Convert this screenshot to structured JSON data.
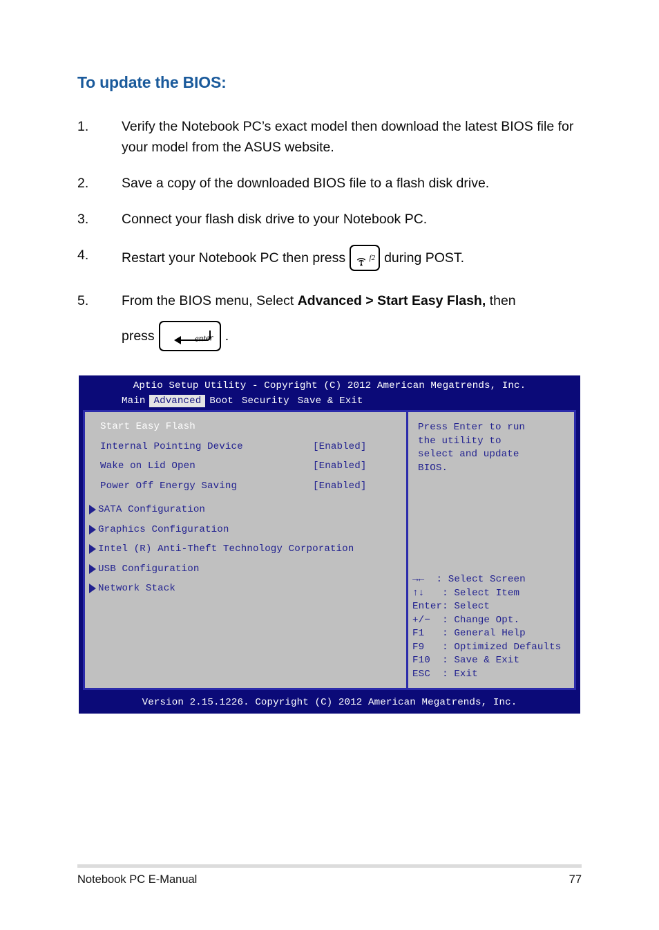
{
  "heading": "To update the BIOS:",
  "steps": [
    {
      "num": "1.",
      "text": "Verify the Notebook PC’s exact model then download the latest BIOS file for your model from the ASUS website."
    },
    {
      "num": "2.",
      "text": "Save a copy of the downloaded BIOS file to a flash disk drive."
    },
    {
      "num": "3.",
      "text": "Connect your flash disk drive to your Notebook PC."
    },
    {
      "num": "4.",
      "text_before": "Restart your Notebook PC then press",
      "key": {
        "fn_label": "f2",
        "icon": "wireless-icon"
      },
      "text_after": "during POST."
    },
    {
      "num": "5.",
      "text_before": "From the BIOS menu, Select ",
      "bold_1": "Advanced > Start Easy Flash,",
      "text_after": " then",
      "press_label": "press",
      "key": {
        "label": "enter",
        "icon": "enter-arrow-icon"
      },
      "period": "."
    }
  ],
  "bios": {
    "title": "Aptio Setup Utility - Copyright (C) 2012 American Megatrends, Inc.",
    "menu_tabs": [
      {
        "label": "Main",
        "active": false
      },
      {
        "label": "Advanced",
        "active": true
      },
      {
        "label": "Boot",
        "active": false
      },
      {
        "label": "Security",
        "active": false
      },
      {
        "label": "Save & Exit",
        "active": false
      }
    ],
    "options": [
      {
        "label": "Start Easy Flash",
        "value": "",
        "selected": true,
        "submenu": false
      },
      {
        "label": "Internal Pointing Device",
        "value": "[Enabled]",
        "selected": false,
        "submenu": false
      },
      {
        "label": "Wake on Lid Open",
        "value": "[Enabled]",
        "selected": false,
        "submenu": false
      },
      {
        "label": "Power Off Energy Saving",
        "value": "[Enabled]",
        "selected": false,
        "submenu": false
      },
      {
        "label": "SATA Configuration",
        "value": "",
        "selected": false,
        "submenu": true
      },
      {
        "label": "Graphics Configuration",
        "value": "",
        "selected": false,
        "submenu": true
      },
      {
        "label": "Intel (R) Anti-Theft Technology Corporation",
        "value": "",
        "selected": false,
        "submenu": true
      },
      {
        "label": "USB Configuration",
        "value": "",
        "selected": false,
        "submenu": true
      },
      {
        "label": "Network Stack",
        "value": "",
        "selected": false,
        "submenu": true
      }
    ],
    "help_lines": [
      "Press Enter to run",
      "the utility to",
      "select and update",
      "BIOS."
    ],
    "key_legend": [
      {
        "key": "→←  ",
        "sep": ": ",
        "action": "Select Screen"
      },
      {
        "key": "↑↓   ",
        "sep": ": ",
        "action": "Select Item"
      },
      {
        "key": "Enter",
        "sep": ": ",
        "action": "Select"
      },
      {
        "key": "+/−  ",
        "sep": ": ",
        "action": "Change Opt."
      },
      {
        "key": "F1   ",
        "sep": ": ",
        "action": "General Help"
      },
      {
        "key": "F9   ",
        "sep": ": ",
        "action": "Optimized Defaults"
      },
      {
        "key": "F10  ",
        "sep": ": ",
        "action": "Save & Exit"
      },
      {
        "key": "ESC  ",
        "sep": ": ",
        "action": "Exit"
      }
    ],
    "footer": "Version 2.15.1226. Copyright (C) 2012 American Megatrends, Inc."
  },
  "page_footer": {
    "left": "Notebook PC E-Manual",
    "page_number": "77"
  },
  "colors": {
    "heading_blue": "#1a5a9b",
    "bios_header_navy": "#0b0a78",
    "bios_panel_gray": "#c0c0c0",
    "bios_text_blue": "#21218f",
    "bios_border_blue": "#2b2baa",
    "selected_white": "#ffffff"
  }
}
